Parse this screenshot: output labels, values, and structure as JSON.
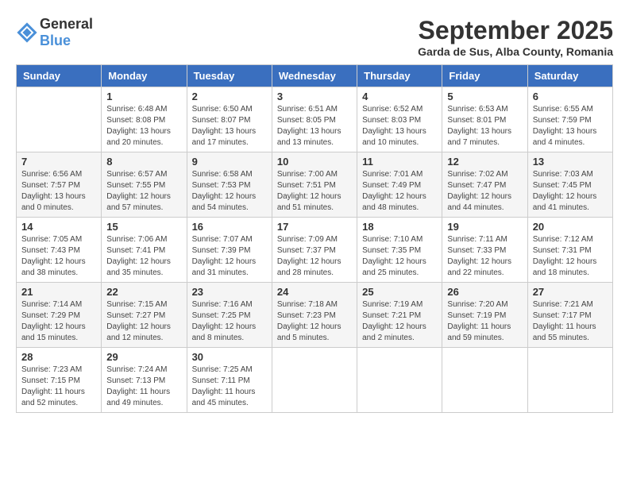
{
  "logo": {
    "general": "General",
    "blue": "Blue"
  },
  "title": "September 2025",
  "subtitle": "Garda de Sus, Alba County, Romania",
  "weekdays": [
    "Sunday",
    "Monday",
    "Tuesday",
    "Wednesday",
    "Thursday",
    "Friday",
    "Saturday"
  ],
  "weeks": [
    [
      {
        "day": "",
        "info": ""
      },
      {
        "day": "1",
        "info": "Sunrise: 6:48 AM\nSunset: 8:08 PM\nDaylight: 13 hours and 20 minutes."
      },
      {
        "day": "2",
        "info": "Sunrise: 6:50 AM\nSunset: 8:07 PM\nDaylight: 13 hours and 17 minutes."
      },
      {
        "day": "3",
        "info": "Sunrise: 6:51 AM\nSunset: 8:05 PM\nDaylight: 13 hours and 13 minutes."
      },
      {
        "day": "4",
        "info": "Sunrise: 6:52 AM\nSunset: 8:03 PM\nDaylight: 13 hours and 10 minutes."
      },
      {
        "day": "5",
        "info": "Sunrise: 6:53 AM\nSunset: 8:01 PM\nDaylight: 13 hours and 7 minutes."
      },
      {
        "day": "6",
        "info": "Sunrise: 6:55 AM\nSunset: 7:59 PM\nDaylight: 13 hours and 4 minutes."
      }
    ],
    [
      {
        "day": "7",
        "info": "Sunrise: 6:56 AM\nSunset: 7:57 PM\nDaylight: 13 hours and 0 minutes."
      },
      {
        "day": "8",
        "info": "Sunrise: 6:57 AM\nSunset: 7:55 PM\nDaylight: 12 hours and 57 minutes."
      },
      {
        "day": "9",
        "info": "Sunrise: 6:58 AM\nSunset: 7:53 PM\nDaylight: 12 hours and 54 minutes."
      },
      {
        "day": "10",
        "info": "Sunrise: 7:00 AM\nSunset: 7:51 PM\nDaylight: 12 hours and 51 minutes."
      },
      {
        "day": "11",
        "info": "Sunrise: 7:01 AM\nSunset: 7:49 PM\nDaylight: 12 hours and 48 minutes."
      },
      {
        "day": "12",
        "info": "Sunrise: 7:02 AM\nSunset: 7:47 PM\nDaylight: 12 hours and 44 minutes."
      },
      {
        "day": "13",
        "info": "Sunrise: 7:03 AM\nSunset: 7:45 PM\nDaylight: 12 hours and 41 minutes."
      }
    ],
    [
      {
        "day": "14",
        "info": "Sunrise: 7:05 AM\nSunset: 7:43 PM\nDaylight: 12 hours and 38 minutes."
      },
      {
        "day": "15",
        "info": "Sunrise: 7:06 AM\nSunset: 7:41 PM\nDaylight: 12 hours and 35 minutes."
      },
      {
        "day": "16",
        "info": "Sunrise: 7:07 AM\nSunset: 7:39 PM\nDaylight: 12 hours and 31 minutes."
      },
      {
        "day": "17",
        "info": "Sunrise: 7:09 AM\nSunset: 7:37 PM\nDaylight: 12 hours and 28 minutes."
      },
      {
        "day": "18",
        "info": "Sunrise: 7:10 AM\nSunset: 7:35 PM\nDaylight: 12 hours and 25 minutes."
      },
      {
        "day": "19",
        "info": "Sunrise: 7:11 AM\nSunset: 7:33 PM\nDaylight: 12 hours and 22 minutes."
      },
      {
        "day": "20",
        "info": "Sunrise: 7:12 AM\nSunset: 7:31 PM\nDaylight: 12 hours and 18 minutes."
      }
    ],
    [
      {
        "day": "21",
        "info": "Sunrise: 7:14 AM\nSunset: 7:29 PM\nDaylight: 12 hours and 15 minutes."
      },
      {
        "day": "22",
        "info": "Sunrise: 7:15 AM\nSunset: 7:27 PM\nDaylight: 12 hours and 12 minutes."
      },
      {
        "day": "23",
        "info": "Sunrise: 7:16 AM\nSunset: 7:25 PM\nDaylight: 12 hours and 8 minutes."
      },
      {
        "day": "24",
        "info": "Sunrise: 7:18 AM\nSunset: 7:23 PM\nDaylight: 12 hours and 5 minutes."
      },
      {
        "day": "25",
        "info": "Sunrise: 7:19 AM\nSunset: 7:21 PM\nDaylight: 12 hours and 2 minutes."
      },
      {
        "day": "26",
        "info": "Sunrise: 7:20 AM\nSunset: 7:19 PM\nDaylight: 11 hours and 59 minutes."
      },
      {
        "day": "27",
        "info": "Sunrise: 7:21 AM\nSunset: 7:17 PM\nDaylight: 11 hours and 55 minutes."
      }
    ],
    [
      {
        "day": "28",
        "info": "Sunrise: 7:23 AM\nSunset: 7:15 PM\nDaylight: 11 hours and 52 minutes."
      },
      {
        "day": "29",
        "info": "Sunrise: 7:24 AM\nSunset: 7:13 PM\nDaylight: 11 hours and 49 minutes."
      },
      {
        "day": "30",
        "info": "Sunrise: 7:25 AM\nSunset: 7:11 PM\nDaylight: 11 hours and 45 minutes."
      },
      {
        "day": "",
        "info": ""
      },
      {
        "day": "",
        "info": ""
      },
      {
        "day": "",
        "info": ""
      },
      {
        "day": "",
        "info": ""
      }
    ]
  ]
}
